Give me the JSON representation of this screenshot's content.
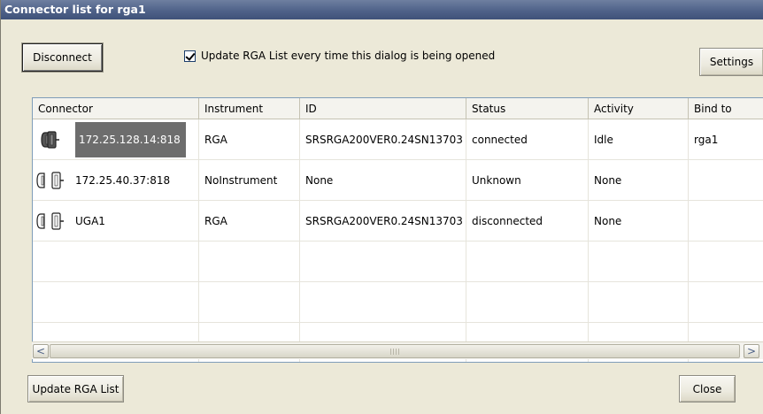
{
  "window": {
    "title": "Connector list for rga1"
  },
  "toolbar": {
    "disconnect_label": "Disconnect",
    "update_checkbox": {
      "label": "Update RGA List every time this dialog is being opened",
      "checked": true
    },
    "settings_label": "Settings"
  },
  "table": {
    "columns": [
      "Connector",
      "Instrument",
      "ID",
      "Status",
      "Activity",
      "Bind to"
    ],
    "rows": [
      {
        "icon": "connected-plug-icon",
        "connector": "172.25.128.14:818",
        "instrument": "RGA",
        "id": "SRSRGA200VER0.24SN13703",
        "status": "connected",
        "activity": "Idle",
        "bind_to": "rga1",
        "selected": true
      },
      {
        "icon": "disconnected-plug-icon",
        "connector": "172.25.40.37:818",
        "instrument": "NoInstrument",
        "id": "None",
        "status": "Unknown",
        "activity": "None",
        "bind_to": "",
        "selected": false
      },
      {
        "icon": "disconnected-plug-icon",
        "connector": "UGA1",
        "instrument": "RGA",
        "id": "SRSRGA200VER0.24SN13703",
        "status": "disconnected",
        "activity": "None",
        "bind_to": "",
        "selected": false
      }
    ],
    "empty_row_count": 2
  },
  "scrollbar": {
    "left_arrow": "<",
    "right_arrow": ">"
  },
  "footer": {
    "update_label": "Update RGA List",
    "close_label": "Close"
  },
  "colors": {
    "title_bar": "#4f6289",
    "dialog_bg": "#ece9d8",
    "selection": "#6d6d6d"
  }
}
